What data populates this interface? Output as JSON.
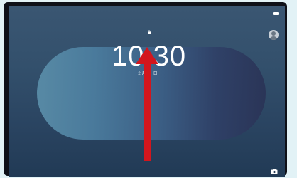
{
  "lockscreen": {
    "time": "10:30",
    "date": "2月　日"
  },
  "icons": {
    "lock": "lock-icon",
    "user": "user-avatar-icon",
    "camera": "camera-icon",
    "battery": "battery-icon"
  },
  "annotation": {
    "gesture": "swipe-up",
    "color": "#d3161d"
  }
}
